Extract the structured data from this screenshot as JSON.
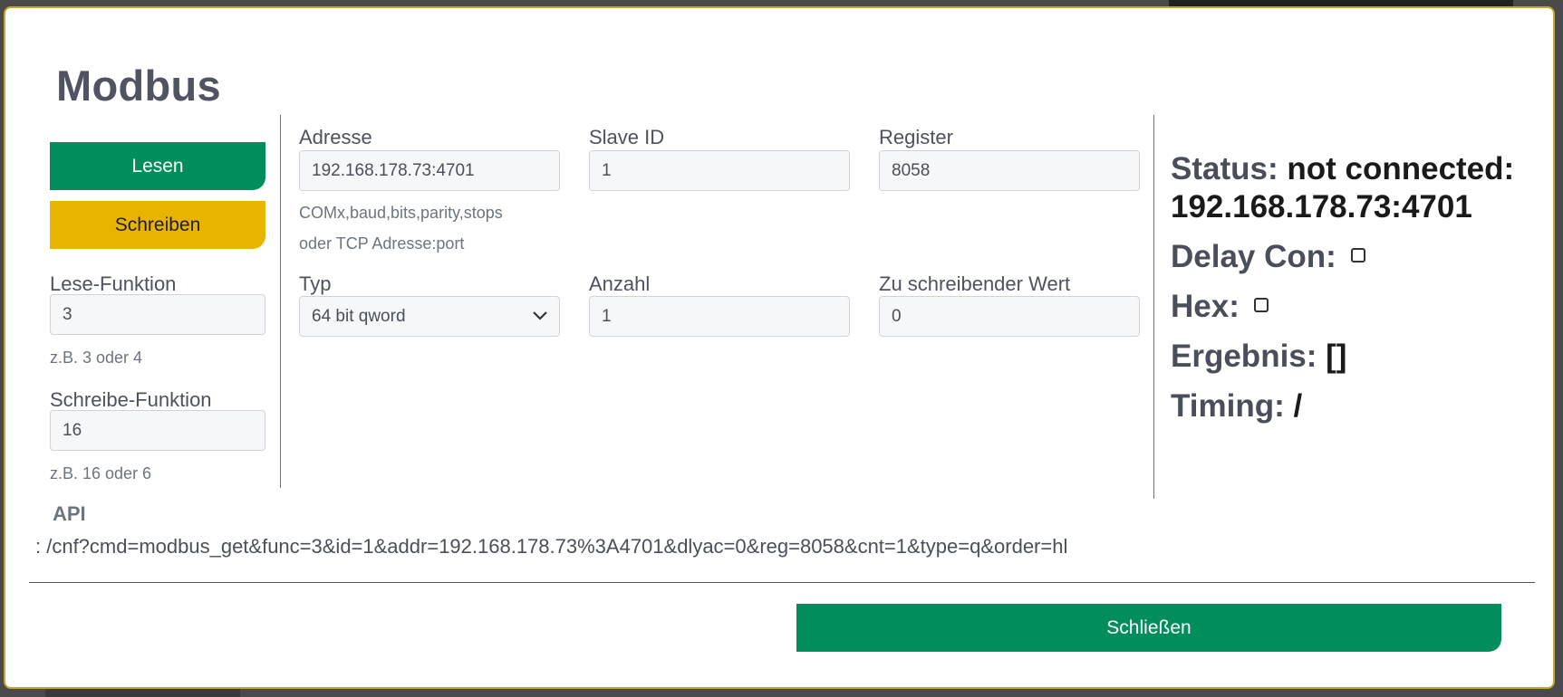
{
  "modal": {
    "title": "Modbus",
    "buttons": {
      "read_label": "Lesen",
      "write_label": "Schreiben",
      "close_label": "Schließen"
    },
    "read_function": {
      "label": "Lese-Funktion",
      "value": "3",
      "hint": "z.B. 3 oder 4"
    },
    "write_function": {
      "label": "Schreibe-Funktion",
      "value": "16",
      "hint": "z.B. 16 oder 6"
    },
    "address": {
      "label": "Adresse",
      "value": "192.168.178.73:4701",
      "hint_line1": "COMx,baud,bits,parity,stops",
      "hint_line2": "oder TCP Adresse:port"
    },
    "slave_id": {
      "label": "Slave ID",
      "value": "1"
    },
    "register": {
      "label": "Register",
      "value": "8058"
    },
    "type": {
      "label": "Typ",
      "value": "64 bit qword"
    },
    "count": {
      "label": "Anzahl",
      "value": "1"
    },
    "write_value": {
      "label": "Zu schreibender Wert",
      "value": "0"
    },
    "status": {
      "status_label": "Status:",
      "status_value_line1": "not connected:",
      "status_value_line2": "192.168.178.73:4701",
      "delay_label": "Delay Con:",
      "hex_label": "Hex:",
      "result_label": "Ergebnis:",
      "result_value": "[]",
      "timing_label": "Timing:",
      "timing_value": "/"
    },
    "api": {
      "title": "API",
      "url": ": /cnf?cmd=modbus_get&func=3&id=1&addr=192.168.178.73%3A4701&dlyac=0&reg=8058&cnt=1&type=q&order=hl"
    }
  }
}
